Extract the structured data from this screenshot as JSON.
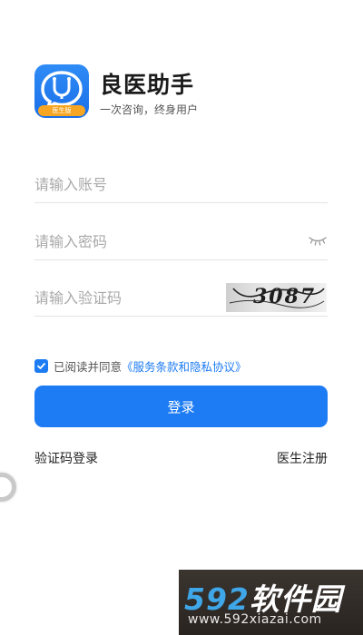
{
  "app": {
    "title": "良医助手",
    "slogan": "一次咨询，终身用户",
    "badge": "医生版"
  },
  "form": {
    "account_placeholder": "请输入账号",
    "password_placeholder": "请输入密码",
    "code_placeholder": "请输入验证码",
    "captcha_text": "3087"
  },
  "agreement": {
    "checked": true,
    "text": "已阅读并同意",
    "link": "《服务条款和隐私协议》"
  },
  "login_label": "登录",
  "links": {
    "code_login": "验证码登录",
    "register": "医生注册"
  },
  "watermark": {
    "brand_num": "592",
    "brand_cn": "软件园",
    "url": "www.592xiazai.com"
  },
  "colors": {
    "accent": "#1d7bf3",
    "badge": "#f6a623"
  }
}
